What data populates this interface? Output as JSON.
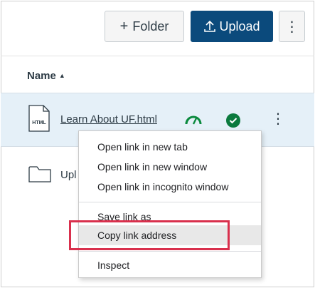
{
  "toolbar": {
    "folder_label": "Folder",
    "folder_icon": "plus-icon",
    "upload_label": "Upload",
    "upload_icon": "upload-icon",
    "more_icon": "kebab-icon"
  },
  "list": {
    "name_header": "Name",
    "sort_icon": "sort-ascending-icon",
    "rows": [
      {
        "name": "Learn About UF.html",
        "file_type_badge": "HTML",
        "icons": [
          "usage-gauge-icon",
          "published-check-icon",
          "kebab-icon"
        ],
        "selected": true
      },
      {
        "name": "Upl",
        "icon": "folder-icon"
      }
    ]
  },
  "context_menu": {
    "items": [
      {
        "label": "Open link in new tab"
      },
      {
        "label": "Open link in new window"
      },
      {
        "label": "Open link in incognito window"
      },
      {
        "label": "Save link as"
      },
      {
        "label": "Copy link address",
        "highlighted": true
      },
      {
        "label": "Inspect"
      }
    ]
  },
  "colors": {
    "upload_button": "#0b4a7c",
    "selected_row": "#e5f0f8",
    "published_check": "#0b7a3e",
    "gauge": "#0b8a3e",
    "highlight_box": "#d9304d"
  }
}
